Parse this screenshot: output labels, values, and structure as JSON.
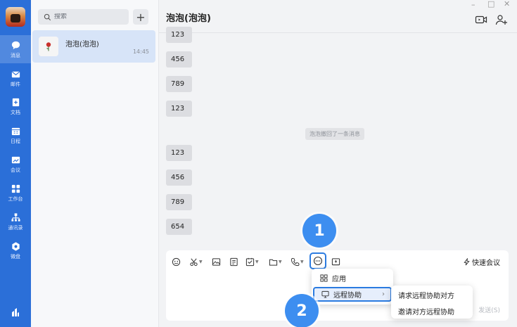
{
  "nav": {
    "items": [
      {
        "label": "消息",
        "icon": "chat-icon"
      },
      {
        "label": "邮件",
        "icon": "mail-icon"
      },
      {
        "label": "文档",
        "icon": "doc-icon"
      },
      {
        "label": "日程",
        "icon": "calendar-icon"
      },
      {
        "label": "会议",
        "icon": "meeting-icon"
      },
      {
        "label": "工作台",
        "icon": "workbench-icon"
      },
      {
        "label": "通讯录",
        "icon": "contacts-icon"
      },
      {
        "label": "微盘",
        "icon": "drive-icon"
      }
    ]
  },
  "search": {
    "placeholder": "搜索"
  },
  "conversation": {
    "name": "泡泡(泡泡)",
    "time": "14:45"
  },
  "chat": {
    "title": "泡泡(泡泡)",
    "messages_before": [
      "123",
      "456",
      "789",
      "123"
    ],
    "system_message": "泡泡撤回了一条消息",
    "messages_after": [
      "123",
      "456",
      "789",
      "654"
    ]
  },
  "input": {
    "quick_meeting": "快速会议",
    "send": "发送(S)"
  },
  "menu": {
    "items": [
      "应用",
      "远程协助"
    ]
  },
  "submenu": {
    "items": [
      "请求远程协助对方",
      "邀请对方远程协助"
    ]
  },
  "callouts": [
    "1",
    "2"
  ],
  "colors": {
    "accent": "#2b6fd8",
    "highlight": "#2b7be0",
    "callout": "#3d8ef0"
  }
}
